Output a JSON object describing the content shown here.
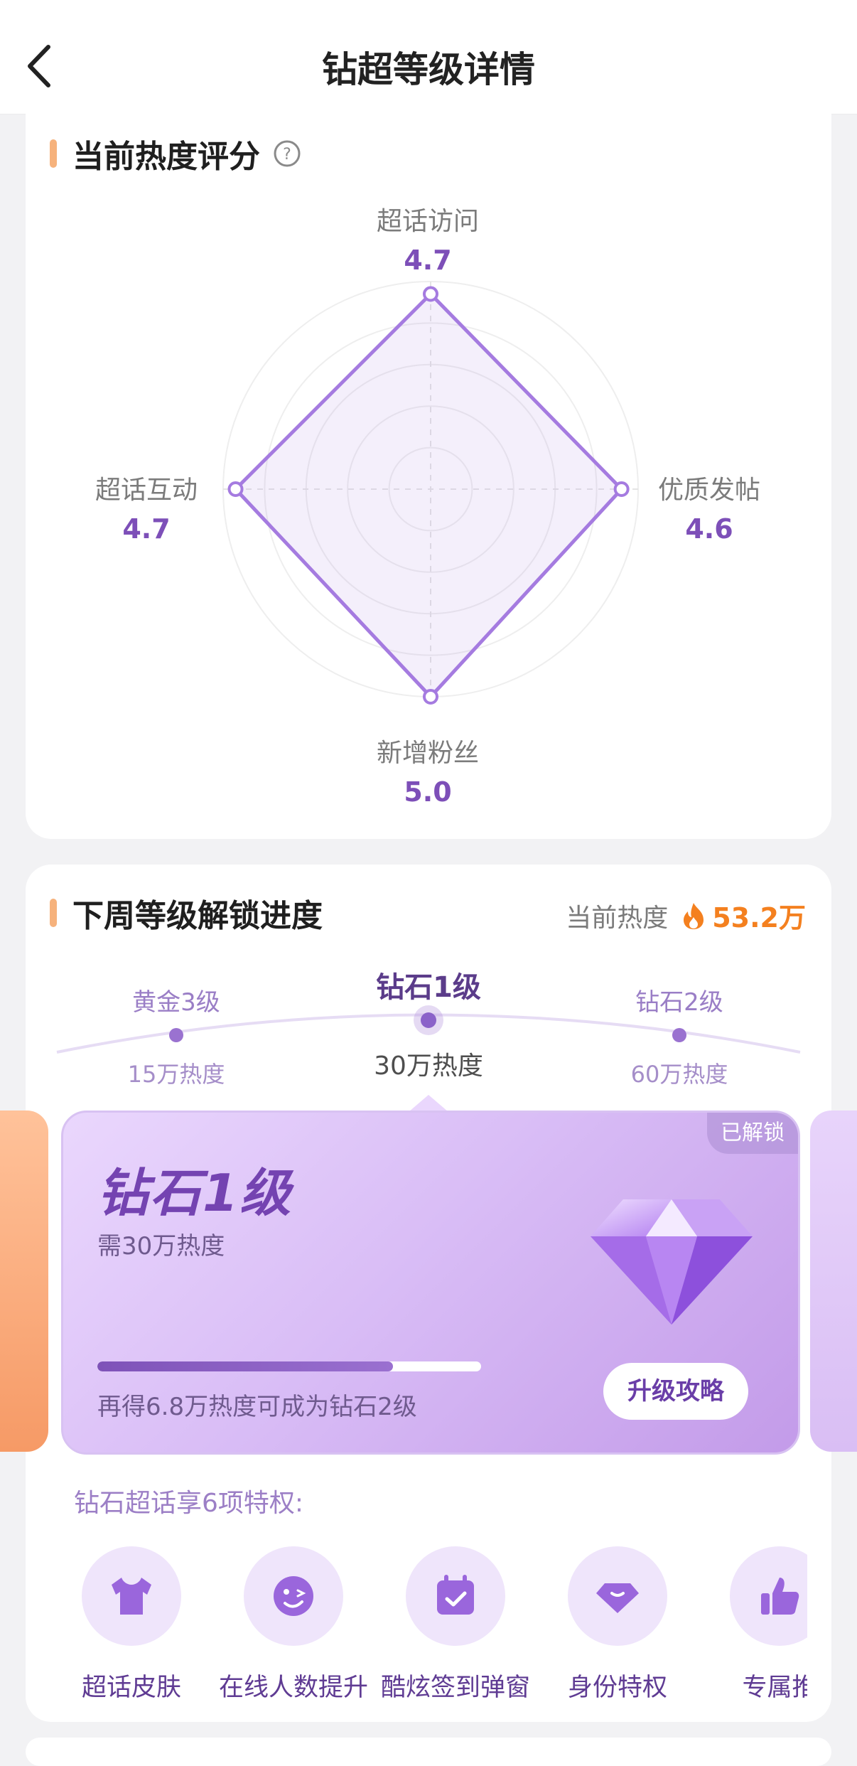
{
  "nav": {
    "title": "钻超等级详情",
    "back_icon": "chevron-left-icon"
  },
  "heat_score": {
    "title": "当前热度评分",
    "help_icon": "question-circle-icon",
    "radar": [
      {
        "name": "超话访问",
        "value": "4.7"
      },
      {
        "name": "优质发帖",
        "value": "4.6"
      },
      {
        "name": "新增粉丝",
        "value": "5.0"
      },
      {
        "name": "超话互动",
        "value": "4.7"
      }
    ],
    "max": 5.0,
    "line_color": "#a57be0"
  },
  "unlock": {
    "title": "下周等级解锁进度",
    "current_heat_label": "当前热度",
    "current_heat_value": "53.2万",
    "levels": [
      {
        "name": "黄金3级",
        "heat": "15万热度"
      },
      {
        "name": "钻石1级",
        "heat": "30万热度"
      },
      {
        "name": "钻石2级",
        "heat": "60万热度"
      }
    ],
    "card": {
      "badge": "已解锁",
      "title": "钻石1级",
      "requirement": "需30万热度",
      "progress": 0.77,
      "tip": "再得6.8万热度可成为钻石2级",
      "button": "升级攻略",
      "icon": "diamond-icon"
    },
    "privileges_title": "钻石超话享6项特权:",
    "privileges": [
      {
        "label": "超话皮肤",
        "icon": "tshirt-icon"
      },
      {
        "label": "在线人数提升",
        "icon": "wink-face-icon"
      },
      {
        "label": "酷炫签到弹窗",
        "icon": "calendar-check-icon"
      },
      {
        "label": "身份特权",
        "icon": "diamond-badge-icon"
      },
      {
        "label": "专属推",
        "icon": "thumbs-up-icon"
      }
    ]
  },
  "colors": {
    "accent": "#8b62c9",
    "orange": "#f4801f",
    "bar": "#f6b27c"
  }
}
